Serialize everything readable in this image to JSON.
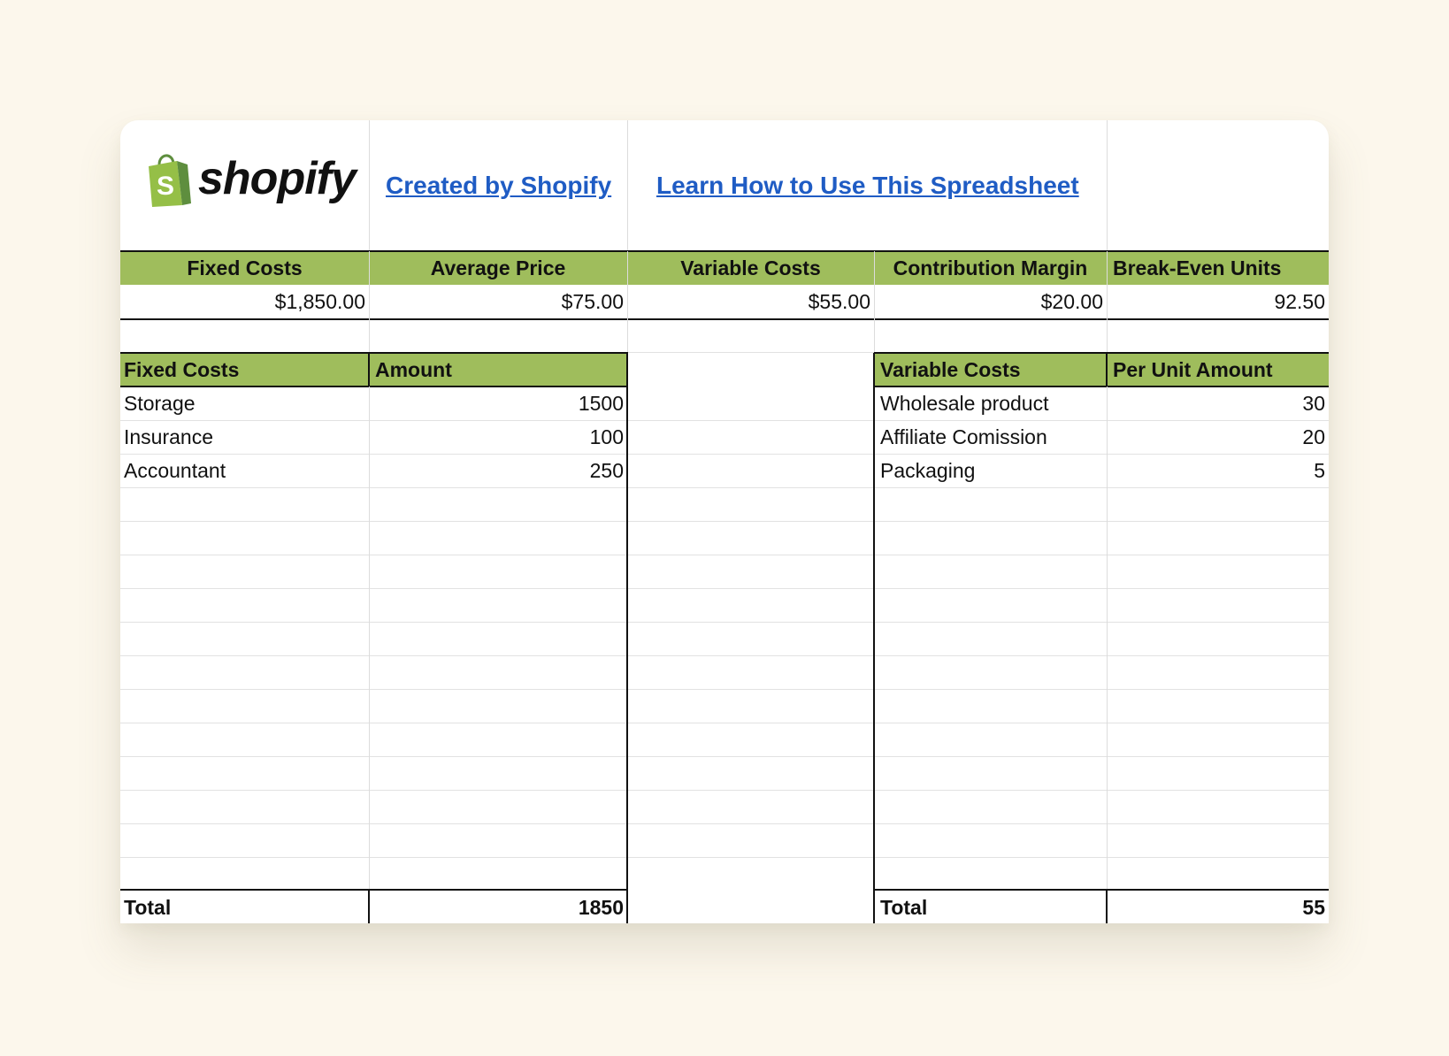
{
  "brand": {
    "name": "shopify",
    "bag_letter": "S",
    "bag_color": "#95bf47",
    "bag_dark": "#5e8e3e"
  },
  "links": {
    "created_by": "Created by Shopify",
    "learn_how": "Learn How to Use This Spreadsheet"
  },
  "summary": {
    "headers": [
      "Fixed Costs",
      "Average Price",
      "Variable Costs",
      "Contribution Margin",
      "Break-Even Units"
    ],
    "values": [
      "$1,850.00",
      "$75.00",
      "$55.00",
      "$20.00",
      "92.50"
    ]
  },
  "fixed_costs": {
    "header_name": "Fixed Costs",
    "header_amount": "Amount",
    "rows": [
      {
        "name": "Storage",
        "amount": "1500"
      },
      {
        "name": "Insurance",
        "amount": "100"
      },
      {
        "name": "Accountant",
        "amount": "250"
      }
    ],
    "total_label": "Total",
    "total_value": "1850"
  },
  "variable_costs": {
    "header_name": "Variable Costs",
    "header_amount": "Per Unit Amount",
    "rows": [
      {
        "name": "Wholesale product",
        "amount": "30"
      },
      {
        "name": "Affiliate Comission",
        "amount": "20"
      },
      {
        "name": "Packaging",
        "amount": "5"
      }
    ],
    "total_label": "Total",
    "total_value": "55"
  },
  "colors": {
    "header_green": "#9fbd5c",
    "link_blue": "#1f5cc4",
    "background": "#fcf7ec"
  }
}
